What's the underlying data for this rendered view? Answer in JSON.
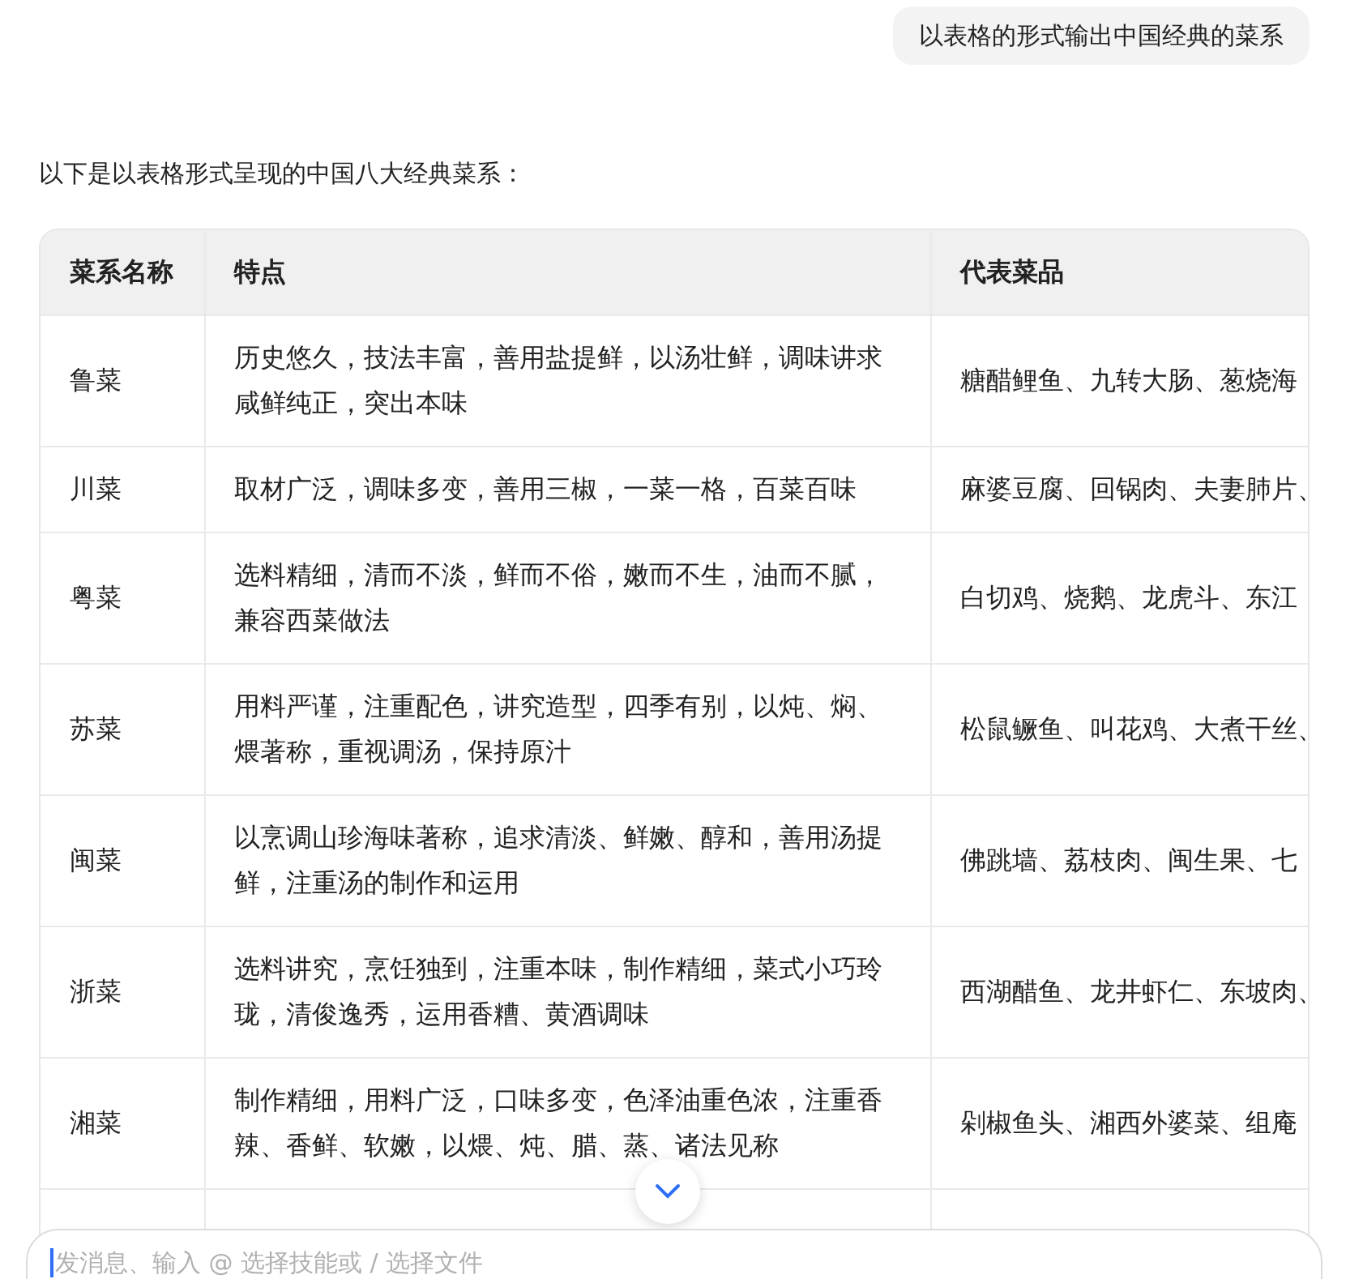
{
  "user_message": "以表格的形式输出中国经典的菜系",
  "intro": "以下是以表格形式呈现的中国八大经典菜系：",
  "table": {
    "columns": [
      "菜系名称",
      "特点",
      "代表菜品"
    ],
    "rows": [
      {
        "name": "鲁菜",
        "features": "历史悠久，技法丰富，善用盐提鲜，以汤壮鲜，调味讲求咸鲜纯正，突出本味",
        "dishes": "糖醋鲤鱼、九转大肠、葱烧海"
      },
      {
        "name": "川菜",
        "features": "取材广泛，调味多变，善用三椒，一菜一格，百菜百味",
        "dishes": "麻婆豆腐、回锅肉、夫妻肺片、"
      },
      {
        "name": "粤菜",
        "features": "选料精细，清而不淡，鲜而不俗，嫩而不生，油而不腻，兼容西菜做法",
        "dishes": "白切鸡、烧鹅、龙虎斗、东江"
      },
      {
        "name": "苏菜",
        "features": "用料严谨，注重配色，讲究造型，四季有别，以炖、焖、煨著称，重视调汤，保持原汁",
        "dishes": "松鼠鳜鱼、叫花鸡、大煮干丝、"
      },
      {
        "name": "闽菜",
        "features": "以烹调山珍海味著称，追求清淡、鲜嫩、醇和，善用汤提鲜，注重汤的制作和运用",
        "dishes": "佛跳墙、荔枝肉、闽生果、七"
      },
      {
        "name": "浙菜",
        "features": "选料讲究，烹饪独到，注重本味，制作精细，菜式小巧玲珑，清俊逸秀，运用香糟、黄酒调味",
        "dishes": "西湖醋鱼、龙井虾仁、东坡肉、"
      },
      {
        "name": "湘菜",
        "features": "制作精细，用料广泛，口味多变，色泽油重色浓，注重香辣、香鲜、软嫩，以煨、炖、腊、蒸、诸法见称",
        "dishes": "剁椒鱼头、湘西外婆菜、组庵"
      }
    ]
  },
  "composer": {
    "placeholder": "发消息、输入 @ 选择技能或 / 选择文件"
  }
}
